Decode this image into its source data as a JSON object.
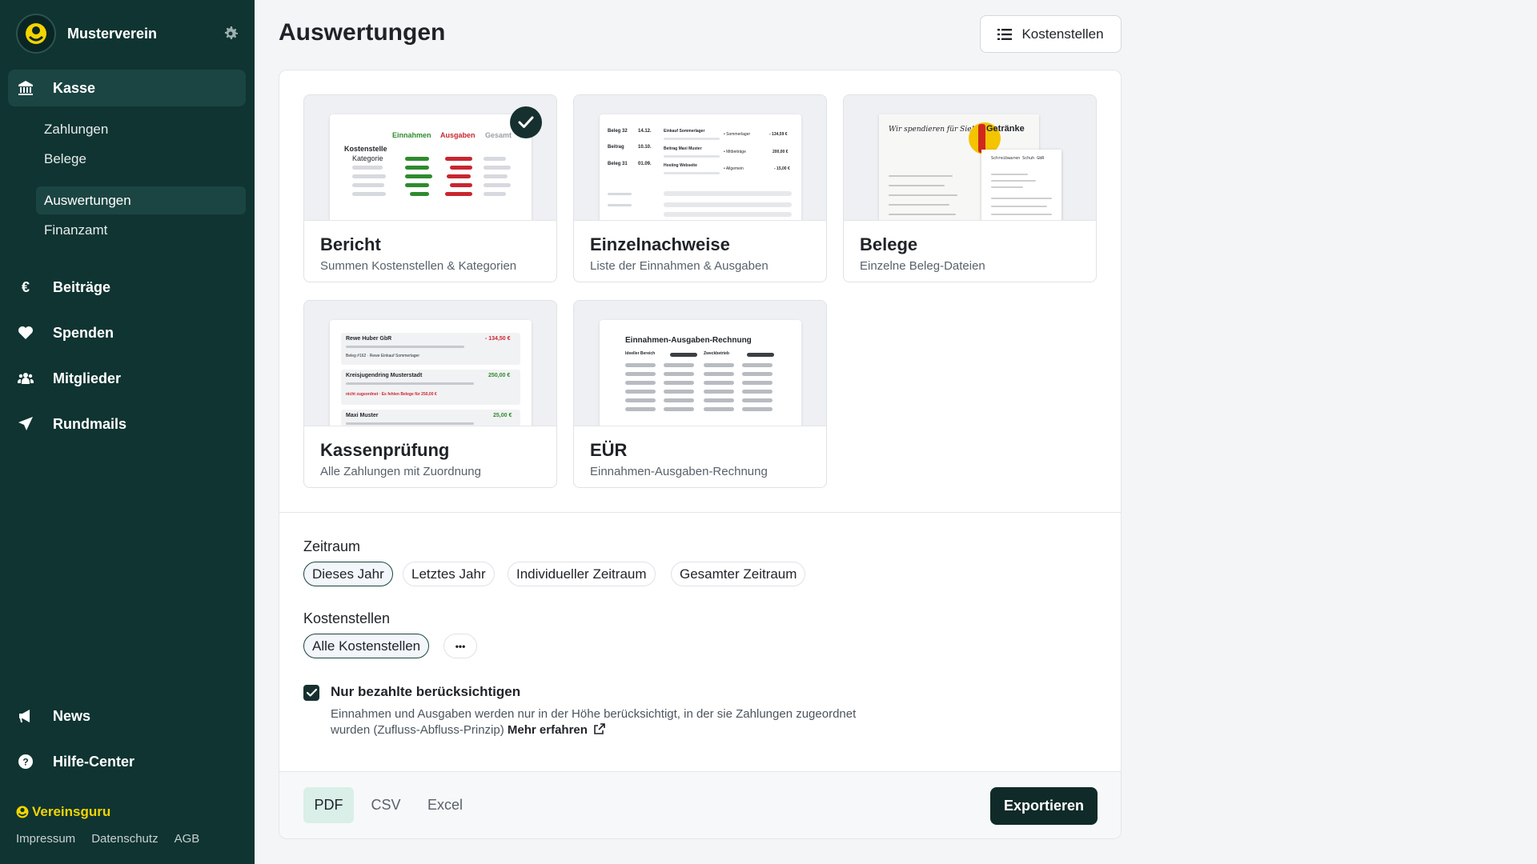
{
  "sidebar": {
    "org_name": "Musterverein",
    "nav": [
      {
        "label": "Kasse"
      },
      {
        "label": "Beiträge"
      },
      {
        "label": "Spenden"
      },
      {
        "label": "Mitglieder"
      },
      {
        "label": "Rundmails"
      },
      {
        "label": "News"
      },
      {
        "label": "Hilfe-Center"
      }
    ],
    "sub": [
      {
        "label": "Zahlungen"
      },
      {
        "label": "Belege"
      },
      {
        "label": "Auswertungen"
      },
      {
        "label": "Finanzamt"
      }
    ],
    "brand": "Vereinsguru",
    "footer_links": [
      "Impressum",
      "Datenschutz",
      "AGB"
    ]
  },
  "header": {
    "title": "Auswertungen",
    "kostenstellen_button": "Kostenstellen"
  },
  "reports": [
    {
      "title": "Bericht",
      "subtitle": "Summen Kostenstellen & Kategorien",
      "selected": true
    },
    {
      "title": "Einzelnachweise",
      "subtitle": "Liste der Einnahmen & Ausgaben",
      "selected": false
    },
    {
      "title": "Belege",
      "subtitle": "Einzelne Beleg-Dateien",
      "selected": false
    },
    {
      "title": "Kassenprüfung",
      "subtitle": "Alle Zahlungen mit Zuordnung",
      "selected": false
    },
    {
      "title": "EÜR",
      "subtitle": "Einnahmen-Ausgaben-Rechnung",
      "selected": false
    }
  ],
  "thumbs": {
    "bericht": {
      "col1": "Einnahmen",
      "col2": "Ausgaben",
      "col3": "Gesamt",
      "row1": "Kostenstelle",
      "row2": "Kategorie"
    },
    "einzel": {
      "rows": [
        {
          "beleg": "Beleg 32",
          "date": "14.12.",
          "text": "Einkauf Sommerlager",
          "tag": "• Sommerlager",
          "amount": "- 134,59 €"
        },
        {
          "beleg": "Beitrag",
          "date": "10.10.",
          "text": "Beitrag Maxi Muster",
          "tag": "• Mitbeiträge",
          "amount": "200,00 €"
        },
        {
          "beleg": "Beleg 31",
          "date": "01.09.",
          "text": "Hosting Webseite",
          "tag": "• Allgemein",
          "amount": "- 15,00 €"
        }
      ]
    },
    "belege": {
      "greeting": "Wir spendieren für Sie!",
      "drinks": "Getränke",
      "shop": "Schreibwaren Schuh GbR"
    },
    "kasse": {
      "r1_name": "Rewe Huber GbR",
      "r1_amount": "- 134,50 €",
      "r1_sub": "Beleg #162 · Rewe Einkauf Sommerlager",
      "r2_name": "Kreisjugendring Musterstadt",
      "r2_amount": "250,00 €",
      "r2_sub": "nicht zugeordnet · Es fehlen Belege für 250,00 €",
      "r3_name": "Maxi Muster",
      "r3_amount": "25,00 €"
    },
    "eur": {
      "title": "Einnahmen-Ausgaben-Rechnung",
      "col1": "Ideeller Bereich",
      "col2": "Zweckbetrieb"
    }
  },
  "zeitraum": {
    "label": "Zeitraum",
    "options": [
      "Dieses Jahr",
      "Letztes Jahr",
      "Individueller Zeitraum",
      "Gesamter Zeitraum"
    ],
    "selected": "Dieses Jahr"
  },
  "kostenstellen": {
    "label": "Kostenstellen",
    "options": [
      "Alle Kostenstellen"
    ],
    "more_label": "•••"
  },
  "paid_only": {
    "checked": true,
    "label": "Nur bezahlte berücksichtigen",
    "help": "Einnahmen und Ausgaben werden nur in der Höhe berücksichtigt, in der sie Zahlungen zugeordnet wurden (Zufluss-Abfluss-Prinzip)",
    "link": "Mehr erfahren"
  },
  "export": {
    "formats": [
      "PDF",
      "CSV",
      "Excel"
    ],
    "selected_format": "PDF",
    "button": "Exportieren"
  },
  "colors": {
    "sidebar_bg": "#0f3432",
    "brand_yellow": "#f4d400",
    "primary_dark": "#0f2a28",
    "income_green": "#2e8b2e",
    "expense_red": "#c9262f"
  }
}
